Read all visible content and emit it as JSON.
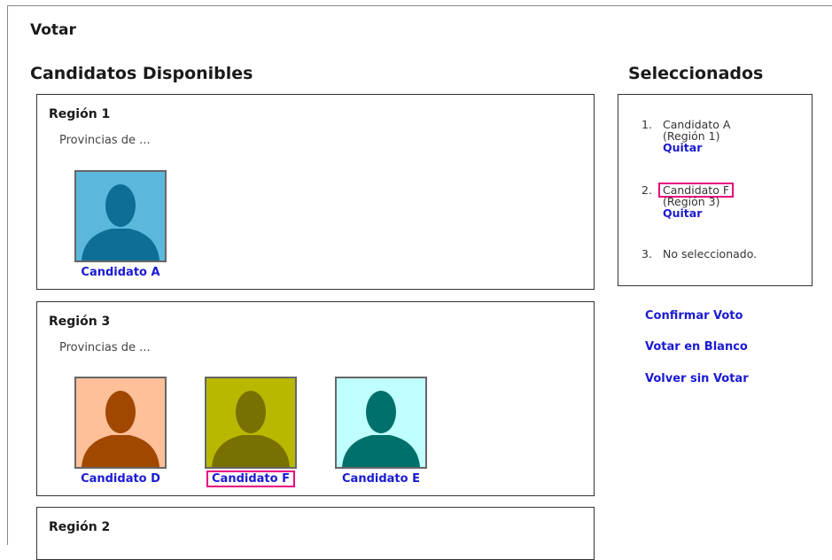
{
  "page": {
    "title": "Votar"
  },
  "available": {
    "heading": "Candidatos Disponibles",
    "regions": [
      {
        "name": "Región 1",
        "desc": "Provincias de ...",
        "candidates": [
          {
            "name": "Candidato A",
            "bg": "#5bb8dd",
            "fg": "#0f6e96"
          }
        ]
      },
      {
        "name": "Región 3",
        "desc": "Provincias de ...",
        "candidates": [
          {
            "name": "Candidato D",
            "bg": "#ffbf99",
            "fg": "#a04800"
          },
          {
            "name": "Candidato F",
            "bg": "#b8b800",
            "fg": "#787000"
          },
          {
            "name": "Candidato E",
            "bg": "#bfffff",
            "fg": "#00706a"
          }
        ]
      },
      {
        "name": "Región 2"
      }
    ]
  },
  "selected": {
    "heading": "Seleccionados",
    "items": [
      {
        "num": "1.",
        "name": "Candidato A",
        "region": "(Región 1)",
        "remove": "Quitar"
      },
      {
        "num": "2.",
        "name": "Candidato F",
        "region": "(Región 3)",
        "remove": "Quitar"
      },
      {
        "num": "3.",
        "empty": "No seleccionado."
      }
    ]
  },
  "actions": {
    "confirm": "Confirmar Voto",
    "blank": "Votar en Blanco",
    "back": "Volver sin Votar"
  },
  "colors": {
    "link": "#1a1ad4",
    "highlight": "#e6007e"
  }
}
